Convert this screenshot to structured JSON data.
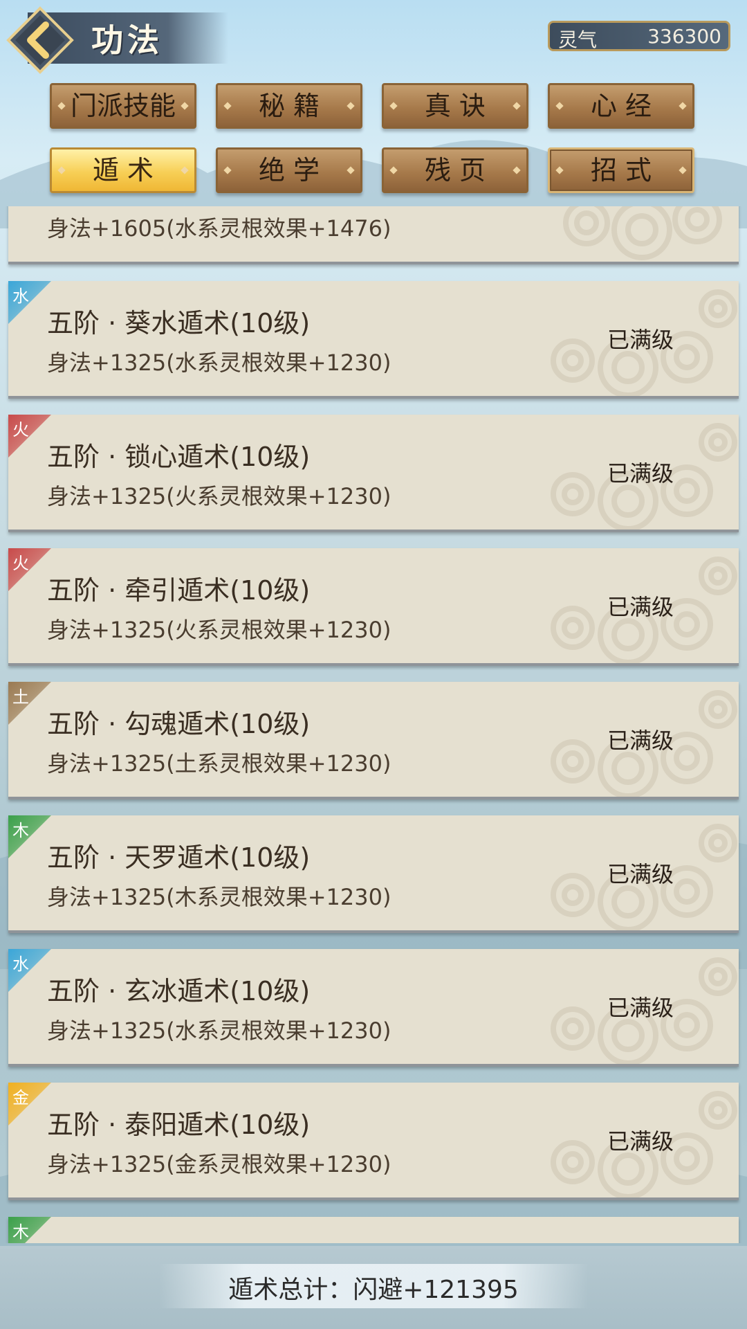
{
  "header": {
    "title": "功法",
    "currency": {
      "label": "灵气",
      "value": "336300"
    }
  },
  "tabs": [
    {
      "label": "门派技能"
    },
    {
      "label": "秘 籍"
    },
    {
      "label": "真 诀"
    },
    {
      "label": "心 经"
    },
    {
      "label": "遁 术",
      "active": true
    },
    {
      "label": "绝 学"
    },
    {
      "label": "残 页"
    },
    {
      "label": "招 式"
    }
  ],
  "partial_top": {
    "effect": "身法+1605(水系灵根效果+1476)"
  },
  "skills": [
    {
      "element": "水",
      "color": "#3aa6d8",
      "name": "五阶 · 葵水遁术(10级)",
      "effect": "身法+1325(水系灵根效果+1230)",
      "status": "已满级"
    },
    {
      "element": "火",
      "color": "#c84a4a",
      "name": "五阶 · 锁心遁术(10级)",
      "effect": "身法+1325(火系灵根效果+1230)",
      "status": "已满级"
    },
    {
      "element": "火",
      "color": "#c84a4a",
      "name": "五阶 · 牵引遁术(10级)",
      "effect": "身法+1325(火系灵根效果+1230)",
      "status": "已满级"
    },
    {
      "element": "土",
      "color": "#9a7a52",
      "name": "五阶 · 勾魂遁术(10级)",
      "effect": "身法+1325(土系灵根效果+1230)",
      "status": "已满级"
    },
    {
      "element": "木",
      "color": "#3aa04a",
      "name": "五阶 · 天罗遁术(10级)",
      "effect": "身法+1325(木系灵根效果+1230)",
      "status": "已满级"
    },
    {
      "element": "水",
      "color": "#3aa6d8",
      "name": "五阶 · 玄冰遁术(10级)",
      "effect": "身法+1325(水系灵根效果+1230)",
      "status": "已满级"
    },
    {
      "element": "金",
      "color": "#f0b020",
      "name": "五阶 · 泰阳遁术(10级)",
      "effect": "身法+1325(金系灵根效果+1230)",
      "status": "已满级"
    }
  ],
  "partial_bottom": {
    "element": "木",
    "color": "#3aa04a"
  },
  "footer": {
    "summary": "遁术总计：闪避+121395"
  }
}
